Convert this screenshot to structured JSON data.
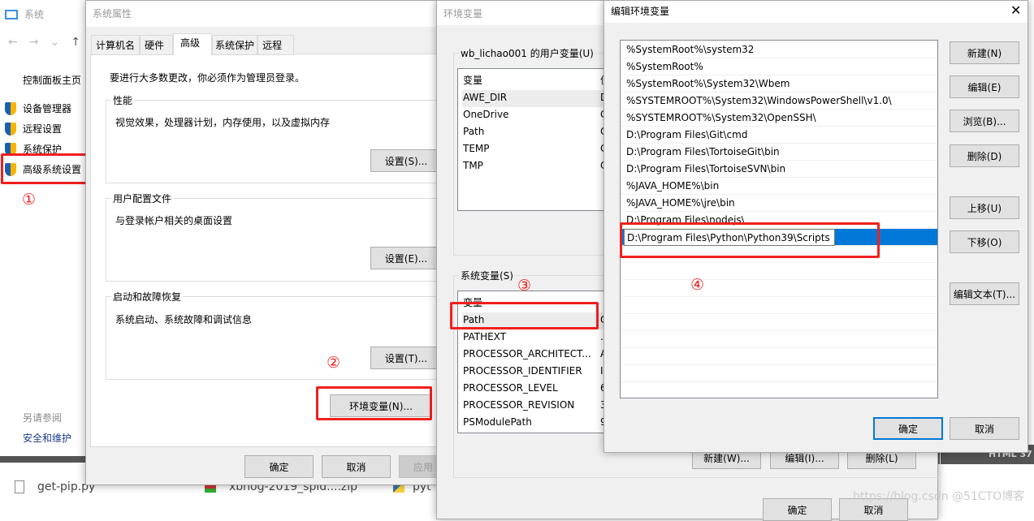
{
  "explorer": {
    "title": "系统",
    "home": "控制面板主页",
    "items": [
      "设备管理器",
      "远程设置",
      "系统保护",
      "高级系统设置"
    ],
    "see_also": "另请参阅",
    "security": "安全和维护"
  },
  "downloads": [
    {
      "name": "get-pip.py"
    },
    {
      "name": "xbnog-2019_spid....zip"
    },
    {
      "name": "pyt"
    }
  ],
  "sysprops": {
    "title": "系统属性",
    "tabs": [
      "计算机名",
      "硬件",
      "高级",
      "系统保护",
      "远程"
    ],
    "active_tab": "高级",
    "admin_note": "要进行大多数更改，你必须作为管理员登录。",
    "perf": {
      "label": "性能",
      "desc": "视觉效果，处理器计划，内存使用，以及虚拟内存",
      "button": "设置(S)..."
    },
    "profile": {
      "label": "用户配置文件",
      "desc": "与登录帐户相关的桌面设置",
      "button": "设置(E)..."
    },
    "startup": {
      "label": "启动和故障恢复",
      "desc": "系统启动、系统故障和调试信息",
      "button": "设置(T)..."
    },
    "env_button": "环境变量(N)...",
    "ok": "确定",
    "cancel": "取消",
    "apply": "应用"
  },
  "envvars": {
    "title": "环境变量",
    "user_label": "wb_lichao001 的用户变量(U)",
    "col_var": "变量",
    "col_val": "值",
    "user_vars": [
      "AWE_DIR",
      "OneDrive",
      "Path",
      "TEMP",
      "TMP"
    ],
    "user_val_initials": [
      "D",
      "C",
      "C",
      "C",
      "C"
    ],
    "sys_label": "系统变量(S)",
    "sys_vars": [
      "Path",
      "PATHEXT",
      "PROCESSOR_ARCHITECT...",
      "PROCESSOR_IDENTIFIER",
      "PROCESSOR_LEVEL",
      "PROCESSOR_REVISION",
      "PSModulePath"
    ],
    "sys_val_initials": [
      "C",
      ".",
      "A",
      "I",
      "6",
      "3",
      "9"
    ],
    "new": "新建(W)...",
    "edit": "编辑(I)...",
    "delete": "删除(L)",
    "ok": "确定",
    "cancel": "取消"
  },
  "editdlg": {
    "title": "编辑环境变量",
    "close": "✕",
    "entries": [
      "%SystemRoot%\\system32",
      "%SystemRoot%",
      "%SystemRoot%\\System32\\Wbem",
      "%SYSTEMROOT%\\System32\\WindowsPowerShell\\v1.0\\",
      "%SYSTEMROOT%\\System32\\OpenSSH\\",
      "D:\\Program Files\\Git\\cmd",
      "D:\\Program Files\\TortoiseGit\\bin",
      "D:\\Program Files\\TortoiseSVN\\bin",
      "%JAVA_HOME%\\bin",
      "%JAVA_HOME%\\jre\\bin",
      "D:\\Program Files\\nodejs\\"
    ],
    "editing_value": "D:\\Program Files\\Python\\Python39\\Scripts",
    "buttons": {
      "new": "新建(N)",
      "edit": "编辑(E)",
      "browse": "浏览(B)...",
      "delete": "删除(D)",
      "up": "上移(U)",
      "down": "下移(O)",
      "edit_text": "编辑文本(T)..."
    },
    "ok": "确定",
    "cancel": "取消"
  },
  "annotations": [
    "①",
    "②",
    "③",
    "④"
  ],
  "background": {
    "html_bar": "HTML 37",
    "watermark": "https://blog.csdn @51CTO博客"
  },
  "colors": {
    "selection": "#0078d7",
    "highlight": "#f0201e"
  }
}
